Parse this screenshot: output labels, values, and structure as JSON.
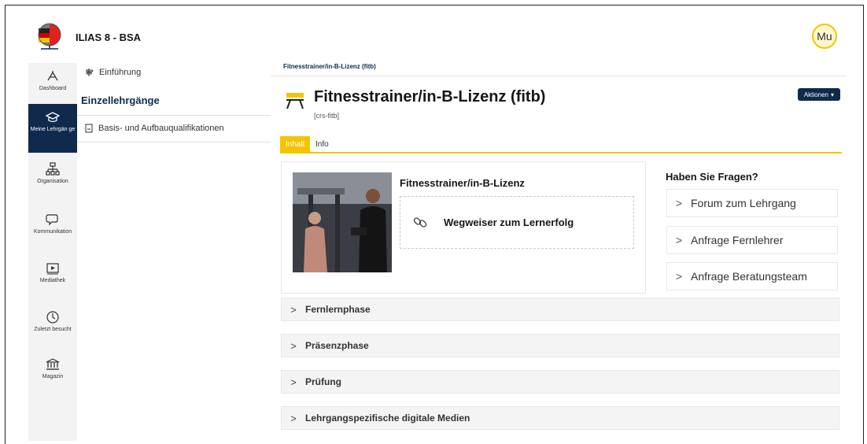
{
  "app": {
    "title": "ILIAS 8 - BSA",
    "avatar_initials": "Mu"
  },
  "mainbar": {
    "items": [
      {
        "label": "Dashboard",
        "icon": "dashboard-icon"
      },
      {
        "label": "Meine Lehrgän ge",
        "icon": "graduation-cap-icon",
        "active": true
      },
      {
        "label": "Organisation",
        "icon": "organisation-icon"
      },
      {
        "label": "Kommunikation",
        "icon": "chat-icon"
      },
      {
        "label": "Mediathek",
        "icon": "play-icon"
      },
      {
        "label": "Zuletzt besucht",
        "icon": "clock-icon"
      },
      {
        "label": "Magazin",
        "icon": "bank-icon"
      }
    ]
  },
  "slate": {
    "intro": "Einführung",
    "heading": "Einzellehrgänge",
    "entry": "Basis- und Aufbauqualifikationen"
  },
  "content": {
    "breadcrumb": "Fitnesstrainer/in-B-Lizenz (fitb)",
    "title": "Fitnesstrainer/in-B-Lizenz (fitb)",
    "subtitle": "[crs-fitb]",
    "actions_label": "Aktionen",
    "tabs": [
      {
        "label": "Inhalt"
      },
      {
        "label": "Info"
      }
    ],
    "teaser": {
      "title": "Fitnesstrainer/in-B-Lizenz",
      "link": "Wegweiser zum Lernerfolg"
    },
    "faq": {
      "heading": "Haben Sie Fragen?",
      "items": [
        "Forum zum Lehrgang",
        "Anfrage Fernlehrer",
        "Anfrage Beratungsteam"
      ]
    },
    "sections": [
      "Fernlernphase",
      "Präsenzphase",
      "Prüfung",
      "Lehrgangspezifische digitale Medien"
    ]
  },
  "colors": {
    "accent": "#f5c400",
    "brand_dark": "#0f2a4d"
  }
}
